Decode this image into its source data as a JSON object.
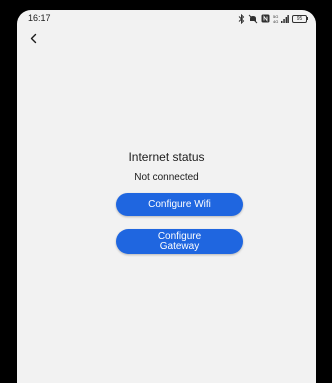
{
  "status_bar": {
    "time": "16:17",
    "icons": [
      "bluetooth-icon",
      "mute-icon",
      "nfc-icon",
      "signal-icon",
      "battery-icon"
    ],
    "battery_level": "95"
  },
  "nav": {
    "back_icon": "back-chevron-icon"
  },
  "main": {
    "title": "Internet status",
    "status": "Not connected",
    "configure_wifi_label": "Configure Wifi",
    "configure_gateway_label": "Configure\nGateway"
  },
  "colors": {
    "button": "#1f66e0",
    "background": "#f2f2f2"
  }
}
